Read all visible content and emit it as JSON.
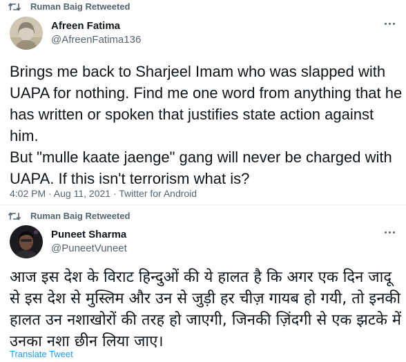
{
  "tweet1": {
    "retweet_label": "Ruman Baig Retweeted",
    "display_name": "Afreen Fatima",
    "handle": "@AfreenFatima136",
    "text": "Brings me back to Sharjeel Imam who was slapped with UAPA for nothing. Find me one word from anything that he has written or spoken that justifies state action against him.\nBut \"mulle kaate jaenge\" gang will never be charged with UAPA. If this isn't terrorism what is?",
    "timestamp": "4:02 PM · Aug 11, 2021 · Twitter for Android"
  },
  "tweet2": {
    "retweet_label": "Ruman Baig Retweeted",
    "display_name": "Puneet Sharma",
    "handle": "@PuneetVuneet",
    "text": "आज इस देश के विराट हिन्दुओं की ये हालत है कि अगर एक दिन जादू से इस देश से मुस्लिम और उन से जुड़ी हर चीज़ गायब हो गयी, तो इनकी हालत उन नशाखोरों की तरह हो जाएगी, जिनकी ज़िंदगी से एक झटके में उनका नशा छीन लिया जाए।",
    "translate_label": "Translate Tweet"
  },
  "icons": {
    "retweet": "retweet-icon",
    "more": "more-options-icon"
  },
  "colors": {
    "text_primary": "#0f1419",
    "text_secondary": "#536471",
    "link": "#1d9bf0",
    "divider": "#eff3f4"
  }
}
